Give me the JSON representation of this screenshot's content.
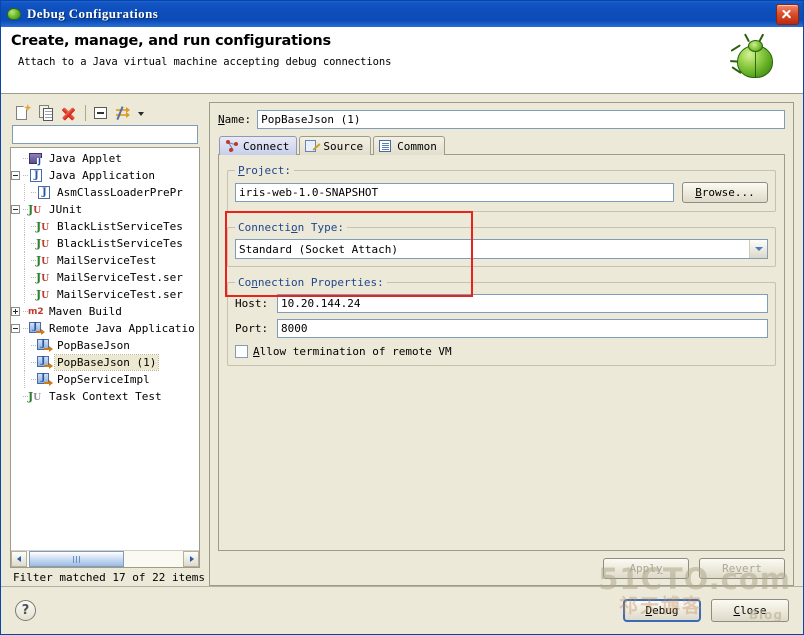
{
  "window": {
    "title": "Debug Configurations",
    "title_icon": "bug-icon",
    "close_label": "close-icon"
  },
  "header": {
    "title": "Create, manage, and run configurations",
    "subtitle": "Attach to a Java virtual machine accepting debug connections",
    "icon": "green-bug-icon"
  },
  "tree_toolbar": {
    "buttons": [
      {
        "name": "new-launch-configuration",
        "icon": "new-page-icon"
      },
      {
        "name": "duplicate-configuration",
        "icon": "copy-icon"
      },
      {
        "name": "delete-configuration",
        "icon": "red-x-icon"
      },
      {
        "name": "collapse-all",
        "icon": "collapse-all-icon"
      },
      {
        "name": "filter-configurations",
        "icon": "filter-arrows-icon"
      }
    ]
  },
  "filter": {
    "value": "",
    "placeholder": "",
    "status": "Filter matched 17 of 22 items"
  },
  "tree": {
    "items": [
      {
        "label": "Java Applet",
        "indent": 1,
        "twisty": "none",
        "icon": "java-applet-icon",
        "selected": false
      },
      {
        "label": "Java Application",
        "indent": 0,
        "twisty": "expanded",
        "icon": "java-app-icon",
        "selected": false
      },
      {
        "label": "AsmClassLoaderPrePr",
        "indent": 2,
        "twisty": "none",
        "icon": "java-app-icon",
        "selected": false
      },
      {
        "label": "JUnit",
        "indent": 0,
        "twisty": "expanded",
        "icon": "junit-icon",
        "selected": false
      },
      {
        "label": "BlackListServiceTes",
        "indent": 2,
        "twisty": "none",
        "icon": "junit-icon",
        "selected": false
      },
      {
        "label": "BlackListServiceTes",
        "indent": 2,
        "twisty": "none",
        "icon": "junit-icon",
        "selected": false
      },
      {
        "label": "MailServiceTest",
        "indent": 2,
        "twisty": "none",
        "icon": "junit-icon",
        "selected": false
      },
      {
        "label": "MailServiceTest.ser",
        "indent": 2,
        "twisty": "none",
        "icon": "junit-icon",
        "selected": false
      },
      {
        "label": "MailServiceTest.ser",
        "indent": 2,
        "twisty": "none",
        "icon": "junit-icon",
        "selected": false
      },
      {
        "label": "Maven Build",
        "indent": 0,
        "twisty": "collapsed",
        "icon": "maven-m2-icon",
        "selected": false
      },
      {
        "label": "Remote Java Applicatio",
        "indent": 0,
        "twisty": "expanded",
        "icon": "remote-java-icon",
        "selected": false
      },
      {
        "label": "PopBaseJson",
        "indent": 2,
        "twisty": "none",
        "icon": "remote-java-icon",
        "selected": false
      },
      {
        "label": "PopBaseJson (1)",
        "indent": 2,
        "twisty": "none",
        "icon": "remote-java-icon",
        "selected": true
      },
      {
        "label": "PopServiceImpl",
        "indent": 2,
        "twisty": "none",
        "icon": "remote-java-icon",
        "selected": false
      },
      {
        "label": "Task Context Test",
        "indent": 1,
        "twisty": "none",
        "icon": "junit-gray-icon",
        "selected": false
      }
    ]
  },
  "config": {
    "name_label": "Name:",
    "name_label_mnemonic": "N",
    "name_value": "PopBaseJson (1)",
    "tabs": [
      {
        "label": "Connect",
        "icon": "connect-icon",
        "active": true
      },
      {
        "label": "Source",
        "icon": "source-icon",
        "active": false
      },
      {
        "label": "Common",
        "icon": "common-icon",
        "active": false
      }
    ],
    "project_group": {
      "legend": "Project:",
      "legend_mnemonic": "P",
      "value": "iris-web-1.0-SNAPSHOT",
      "browse_label": "Browse...",
      "browse_mnemonic": "B"
    },
    "connection_type_group": {
      "legend": "Connection Type:",
      "legend_mnemonic": "o",
      "selected": "Standard (Socket Attach)",
      "options": [
        "Standard (Socket Attach)"
      ]
    },
    "connection_properties_group": {
      "legend": "Connection Properties:",
      "legend_mnemonic": "n",
      "host_label": "Host:",
      "host_value": "10.20.144.24",
      "port_label": "Port:",
      "port_value": "8000",
      "allow_term_label": "Allow termination of remote VM",
      "allow_term_mnemonic": "A",
      "allow_term_checked": false
    },
    "apply_label": "Apply",
    "apply_mnemonic": "y",
    "apply_enabled": false,
    "revert_label": "Revert",
    "revert_mnemonic": "v",
    "revert_enabled": false
  },
  "annotation": {
    "color": "#e8231b",
    "shape": "rectangle"
  },
  "footer": {
    "help_label": "?",
    "debug_label": "Debug",
    "debug_mnemonic": "D",
    "close_label": "Close",
    "close_mnemonic": "C"
  },
  "watermark": {
    "main": "51CTO.com",
    "sub": "Blog",
    "cn": "祁天博客"
  }
}
